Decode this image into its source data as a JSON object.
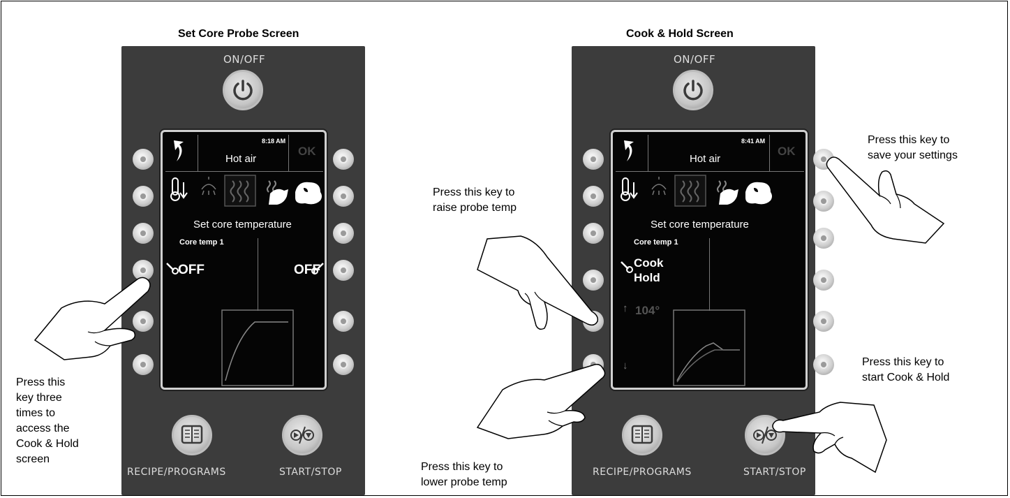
{
  "panels": [
    {
      "title": "Set Core Probe Screen",
      "on_off_label": "ON/OFF",
      "time": "8:18 AM",
      "mode": "Hot air",
      "ok_label": "OK",
      "screen_title": "Set core temperature",
      "core_temp_label": "Core temp 1",
      "left_value": "OFF",
      "right_value": "OFF",
      "recipe_label": "RECIPE/PROGRAMS",
      "start_stop_label": "START/STOP"
    },
    {
      "title": "Cook & Hold Screen",
      "on_off_label": "ON/OFF",
      "time": "8:41 AM",
      "mode": "Hot air",
      "ok_label": "OK",
      "screen_title": "Set core temperature",
      "core_temp_label": "Core temp 1",
      "cook_label": "Cook",
      "hold_label": "Hold",
      "temp_value": "104°",
      "recipe_label": "RECIPE/PROGRAMS",
      "start_stop_label": "START/STOP"
    }
  ],
  "annotations": {
    "access_cook_hold": [
      "Press this",
      "key three",
      "times to",
      "access the",
      "Cook & Hold",
      "screen"
    ],
    "raise_probe": [
      "Press this key to",
      "raise probe temp"
    ],
    "lower_probe": [
      "Press this key to",
      "lower probe temp"
    ],
    "save_settings": [
      "Press this key to",
      "save your settings"
    ],
    "start_cook_hold": [
      "Press this key to",
      "start Cook & Hold"
    ]
  },
  "icons": [
    "power-icon",
    "back-arrow-icon",
    "thermometer-down-icon",
    "steam-icon",
    "hot-air-icon",
    "combi-icon",
    "recipe-book-icon",
    "start-stop-icon",
    "probe-icon",
    "pointing-hand-icon"
  ],
  "colors": {
    "panel": "#3c3c3c",
    "screen": "#050505",
    "button": "#c6c6c6"
  }
}
